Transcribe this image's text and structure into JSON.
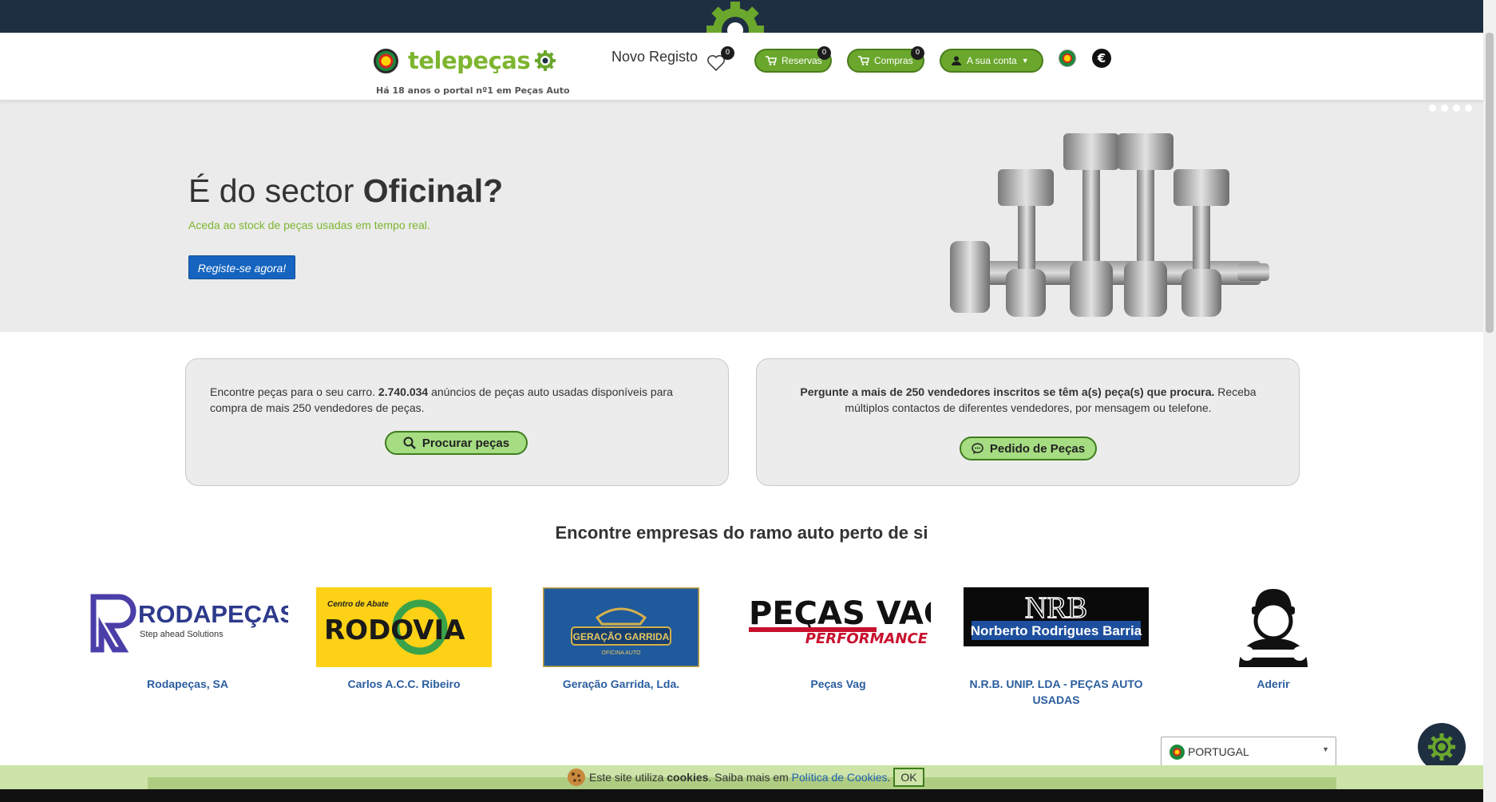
{
  "colors": {
    "top_bar": "#1f2f42",
    "brand_green": "#7db52f",
    "pill_green": "#6aa72c",
    "light_green_button": "#a6dc82",
    "link_blue": "#2a5d9e",
    "hero_bg": "#ebebeb",
    "cta_blue": "#1565c0"
  },
  "header": {
    "logo_text": "telepeças",
    "tagline": "Há 18 anos o portal nº1 em Peças Auto",
    "novo_registo": "Novo Registo",
    "wishlist_count": "0",
    "reservas": {
      "label": "Reservas",
      "count": "0"
    },
    "compras": {
      "label": "Compras",
      "count": "0"
    },
    "account": {
      "label": "A sua conta"
    },
    "currency_symbol": "€"
  },
  "hero": {
    "title_regular": "É do sector ",
    "title_bold": "Oficinal?",
    "subtitle": "Aceda ao stock de peças usadas em tempo real.",
    "cta": "Registe-se agora!"
  },
  "cards": {
    "search": {
      "text_before": "Encontre peças para o seu carro. ",
      "count": "2.740.034",
      "text_after": " anúncios de peças auto usadas disponíveis para compra de mais 250 vendedores de peças.",
      "button": "Procurar peças"
    },
    "request": {
      "text_bold": "Pergunte a mais de 250 vendedores inscritos se têm a(s) peça(s) que procura.",
      "text_after": " Receba múltiplos contactos de diferentes vendedores, por mensagem ou telefone.",
      "button": "Pedido de Peças"
    }
  },
  "companies_section": {
    "title": "Encontre empresas do ramo auto perto de si",
    "companies": [
      {
        "name": "Rodapeças, SA",
        "logo_text": "RODAPEÇAS",
        "logo_sub": "Step ahead Solutions"
      },
      {
        "name": "Carlos A.C.C. Ribeiro",
        "logo_text": "RODOVIA",
        "logo_sub": "Centro de Abate"
      },
      {
        "name": "Geração Garrida, Lda.",
        "logo_text": "GERAÇÃO GARRIDA",
        "logo_sub": "OFICINA AUTO"
      },
      {
        "name": "Peças Vag",
        "logo_text": "PEÇAS VAG",
        "logo_sub": "PERFORMANCE"
      },
      {
        "name": "N.R.B. UNIP. LDA - PEÇAS AUTO USADAS",
        "logo_text": "NRB",
        "logo_sub": "Norberto Rodrigues Barria"
      },
      {
        "name": "Aderir"
      }
    ]
  },
  "country_select": {
    "value": "PORTUGAL"
  },
  "cookie": {
    "text_before": "Este site utiliza ",
    "bold": "cookies",
    "text_middle": ". Saiba mais em ",
    "link": "Política de Cookies",
    "text_end": ".",
    "ok": "OK"
  },
  "icons": [
    "gear-icon",
    "heart-icon",
    "cart-icon",
    "user-icon",
    "caret-down-icon",
    "search-icon",
    "chat-icon",
    "cookie-icon",
    "euro-icon",
    "flag-icon"
  ]
}
